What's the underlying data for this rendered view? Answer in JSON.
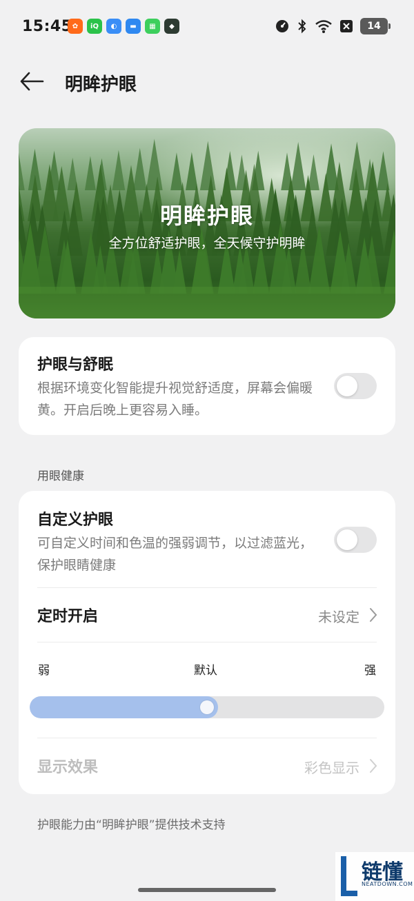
{
  "status_bar": {
    "time": "15:45",
    "battery": "14",
    "app_icons": [
      {
        "name": "taobao-app-icon",
        "color": "#ff6a1a",
        "glyph": "✿"
      },
      {
        "name": "iqiyi-app-icon",
        "color": "#2bc24a",
        "glyph": "iQ"
      },
      {
        "name": "browser-app-icon",
        "color": "#3a8ef6",
        "glyph": "◐"
      },
      {
        "name": "wallet-app-icon",
        "color": "#2f88f0",
        "glyph": "▬"
      },
      {
        "name": "grid-app-icon",
        "color": "#3dcf5d",
        "glyph": "▦"
      },
      {
        "name": "security-app-icon",
        "color": "#2d3b32",
        "glyph": "◆"
      }
    ]
  },
  "header": {
    "title": "明眸护眼"
  },
  "hero": {
    "title": "明眸护眼",
    "subtitle": "全方位舒适护眼，全天候守护明眸"
  },
  "eye_sleep": {
    "title": "护眼与舒眠",
    "description": "根据环境变化智能提升视觉舒适度，屏幕会偏暖黄。开启后晚上更容易入睡。",
    "enabled": false
  },
  "section_label": "用眼健康",
  "custom_eye_care": {
    "title": "自定义护眼",
    "description": "可自定义时间和色温的强弱调节，以过滤蓝光，保护眼睛健康",
    "enabled": false
  },
  "schedule": {
    "label": "定时开启",
    "value": "未设定"
  },
  "intensity": {
    "weak_label": "弱",
    "default_label": "默认",
    "strong_label": "强",
    "level": 0.5
  },
  "display_effect": {
    "label": "显示效果",
    "value": "彩色显示"
  },
  "footer_note": "护眼能力由“明眸护眼”提供技术支持",
  "watermark": {
    "text": "链懂",
    "sub": "NEATDOWN.COM"
  },
  "colors": {
    "accent": "#a5c0ec",
    "background": "#f1f1f2"
  }
}
